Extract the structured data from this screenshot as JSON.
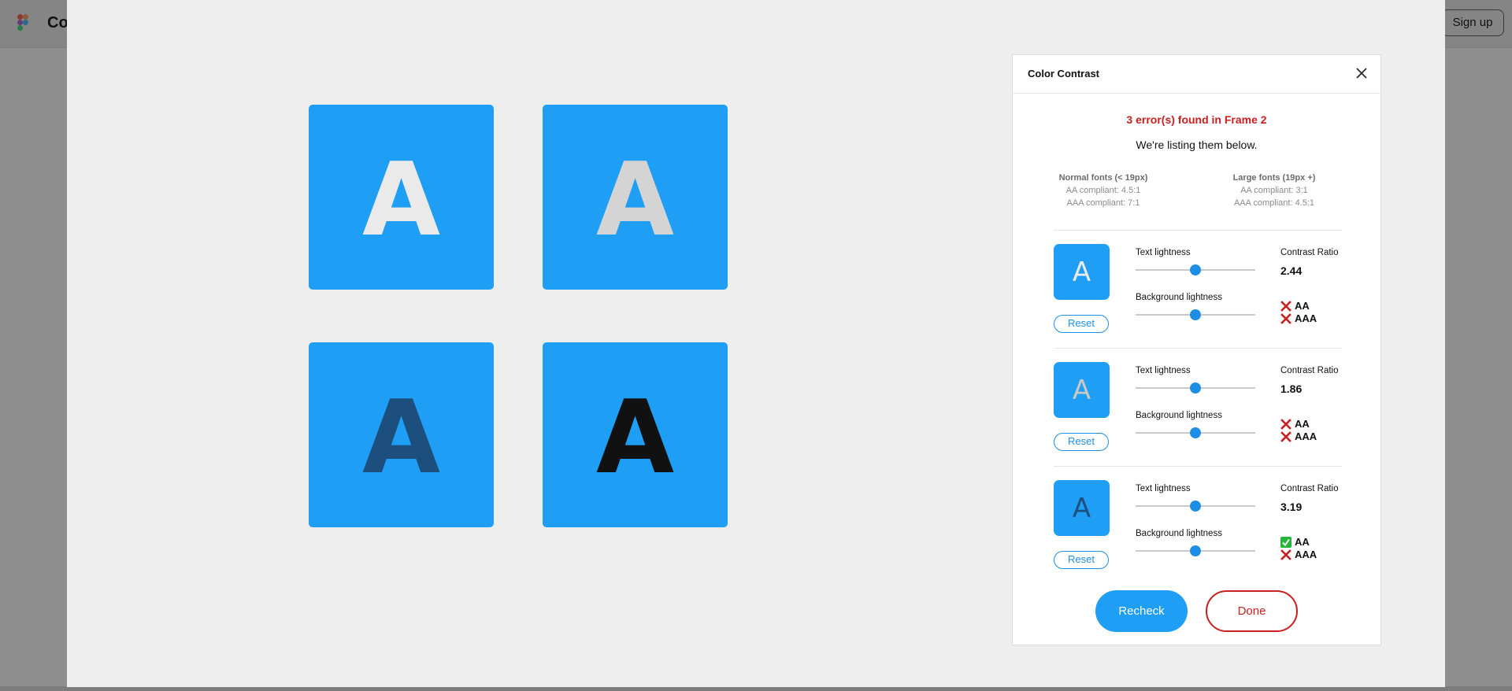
{
  "background": {
    "title": "Co",
    "signup_label": "Sign up"
  },
  "colors": {
    "accent": "#1e9ef5",
    "error": "#c91f1f",
    "pass": "#27b53c"
  },
  "canvas": {
    "tiles": [
      {
        "letter": "A",
        "color": "#eaeaea"
      },
      {
        "letter": "A",
        "color": "#d4d4d4"
      },
      {
        "letter": "A",
        "color": "#1d4f7e"
      },
      {
        "letter": "A",
        "color": "#111111"
      }
    ]
  },
  "dialog": {
    "title": "Color Contrast",
    "close_icon": "close-icon",
    "error_summary": "3 error(s) found in Frame 2",
    "subtitle": "We're listing them below.",
    "legend": {
      "normal": {
        "heading": "Normal fonts (< 19px)",
        "aa": "AA compliant: 4.5:1",
        "aaa": "AAA compliant: 7:1"
      },
      "large": {
        "heading": "Large fonts (19px +)",
        "aa": "AA compliant: 3:1",
        "aaa": "AAA compliant: 4.5:1"
      }
    },
    "text_lightness_label": "Text lightness",
    "background_lightness_label": "Background lightness",
    "contrast_ratio_label": "Contrast Ratio",
    "reset_label": "Reset",
    "items": [
      {
        "letter": "A",
        "letter_color": "#eaeaea",
        "text_lightness": 0.5,
        "background_lightness": 0.5,
        "ratio": "2.44",
        "aa": {
          "label": "AA",
          "pass": false
        },
        "aaa": {
          "label": "AAA",
          "pass": false
        }
      },
      {
        "letter": "A",
        "letter_color": "#c8c8c8",
        "text_lightness": 0.5,
        "background_lightness": 0.5,
        "ratio": "1.86",
        "aa": {
          "label": "AA",
          "pass": false
        },
        "aaa": {
          "label": "AAA",
          "pass": false
        }
      },
      {
        "letter": "A",
        "letter_color": "#1d4f7e",
        "text_lightness": 0.5,
        "background_lightness": 0.5,
        "ratio": "3.19",
        "aa": {
          "label": "AA",
          "pass": true
        },
        "aaa": {
          "label": "AAA",
          "pass": false
        }
      }
    ],
    "recheck_label": "Recheck",
    "done_label": "Done"
  }
}
